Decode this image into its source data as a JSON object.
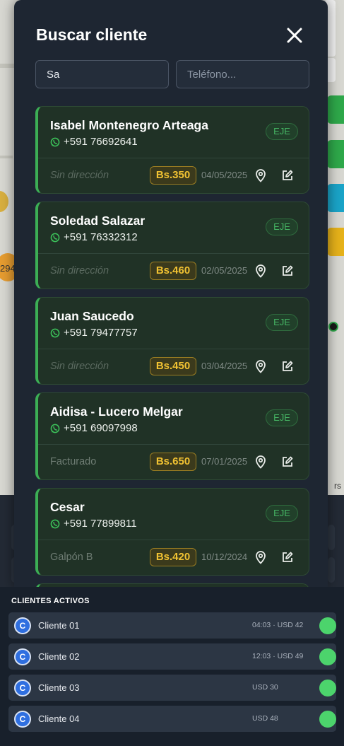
{
  "modal": {
    "title": "Buscar cliente",
    "search_name_value": "Sa",
    "search_phone_placeholder": "Teléfono..."
  },
  "clients": [
    {
      "name": "Isabel Montenegro Arteaga",
      "phone": "+591 76692641",
      "badge": "EJE",
      "address": "Sin dirección",
      "amount": "Bs.350",
      "date": "04/05/2025"
    },
    {
      "name": "Soledad Salazar",
      "phone": "+591 76332312",
      "badge": "EJE",
      "address": "Sin dirección",
      "amount": "Bs.460",
      "date": "02/05/2025"
    },
    {
      "name": "Juan Saucedo",
      "phone": "+591 79477757",
      "badge": "EJE",
      "address": "Sin dirección",
      "amount": "Bs.450",
      "date": "03/04/2025"
    },
    {
      "name": "Aidisa - Lucero Melgar",
      "phone": "+591 69097998",
      "badge": "EJE",
      "address": "Facturado",
      "amount": "Bs.650",
      "date": "07/01/2025"
    },
    {
      "name": "Cesar",
      "phone": "+591 77899811",
      "badge": "EJE",
      "address": "Galpón B",
      "amount": "Bs.420",
      "date": "10/12/2024"
    }
  ],
  "map": {
    "number_label": "294",
    "credit": "rs"
  },
  "active_panel": {
    "title": "CLIENTES ACTIVOS",
    "rows": [
      {
        "initial": "C",
        "name": "Cliente 01",
        "meta": "04:03 · USD 42"
      },
      {
        "initial": "C",
        "name": "Cliente 02",
        "meta": "12:03 · USD 49"
      },
      {
        "initial": "C",
        "name": "Cliente 03",
        "meta": "USD 30"
      },
      {
        "initial": "C",
        "name": "Cliente 04",
        "meta": "USD 48"
      }
    ]
  },
  "colors": {
    "accent_green": "#3cae55",
    "amount_yellow": "#f1c232",
    "status_dot": "#4cd46c",
    "avatar_blue": "#2f6fe0"
  }
}
